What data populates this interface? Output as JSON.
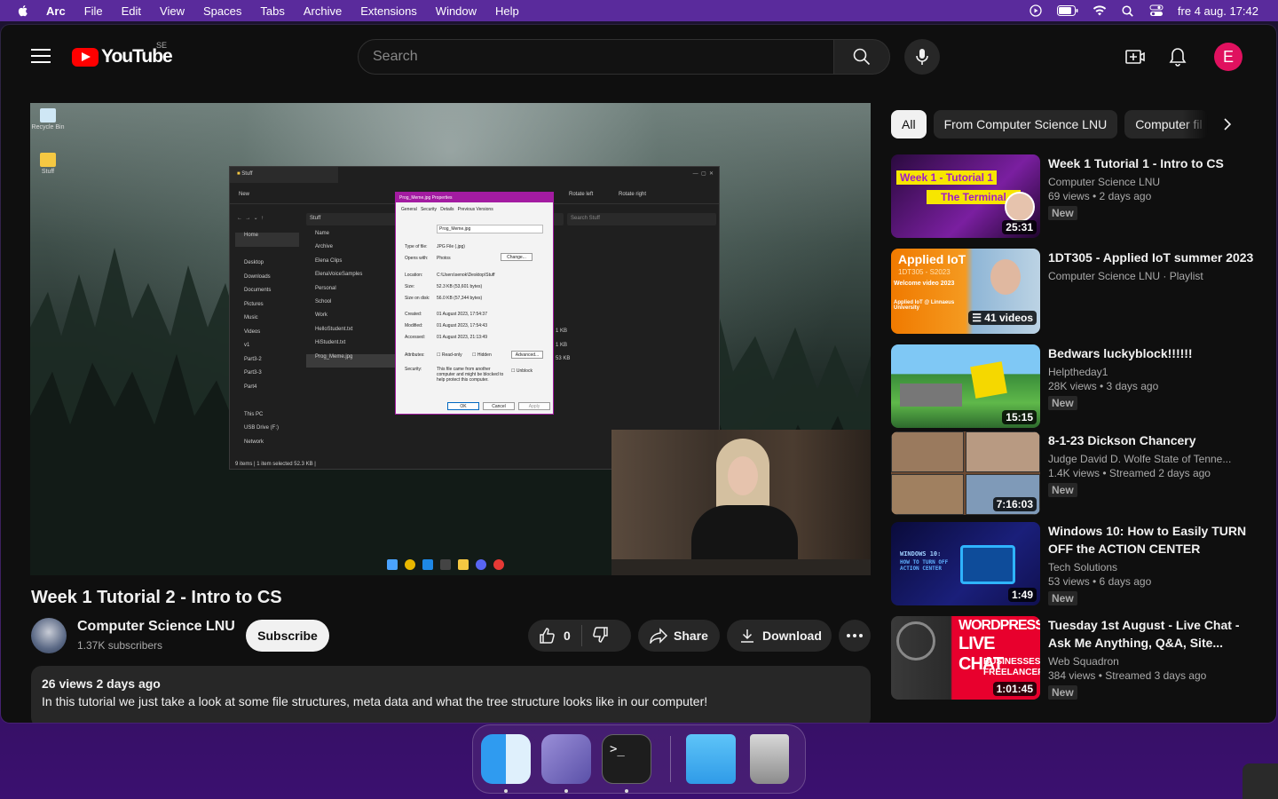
{
  "menubar": {
    "items": [
      "Arc",
      "File",
      "Edit",
      "View",
      "Spaces",
      "Tabs",
      "Archive",
      "Extensions",
      "Window",
      "Help"
    ],
    "clock": "fre 4 aug.  17:42",
    "tray_icons": [
      "play-circle-icon",
      "battery-icon",
      "wifi-icon",
      "spotlight-icon",
      "control-center-icon"
    ]
  },
  "header": {
    "logo_text": "YouTube",
    "region": "SE",
    "search_placeholder": "Search",
    "avatar_letter": "E"
  },
  "video_overlay": {
    "desktop_icons": [
      "Recycle Bin",
      "Stuff"
    ],
    "explorer": {
      "tab": "Stuff",
      "new": "New",
      "rotate_left": "Rotate left",
      "rotate_right": "Rotate right",
      "address": "Stuff",
      "search": "Search Stuff",
      "column_name": "Name",
      "sidebar": [
        "Home",
        "Desktop",
        "Downloads",
        "Documents",
        "Pictures",
        "Music",
        "Videos",
        "v1",
        "Part3-2",
        "Part3-3",
        "Part4",
        "This PC",
        "USB Drive (F:)",
        "Network"
      ],
      "files": [
        "Archive",
        "Elena Clips",
        "ElenaVoiceSamples",
        "Personal",
        "School",
        "Work",
        "HelloStudent.txt",
        "HiStudent.txt",
        "Prog_Meme.jpg"
      ],
      "sizes": [
        "1 KB",
        "1 KB",
        "53 KB"
      ],
      "status": "9 items  |  1 item selected  52.3 KB  |"
    },
    "properties": {
      "title": "Prog_Meme.jpg Properties",
      "tabs": [
        "General",
        "Security",
        "Details",
        "Previous Versions"
      ],
      "filename": "Prog_Meme.jpg",
      "type_label": "Type of file:",
      "type_value": "JPG File (.jpg)",
      "opens_label": "Opens with:",
      "opens_value": "Photos",
      "change": "Change...",
      "location_label": "Location:",
      "location_value": "C:\\Users\\senok\\Desktop\\Stuff",
      "size_label": "Size:",
      "size_value": "52.3 KB (53,601 bytes)",
      "disk_label": "Size on disk:",
      "disk_value": "56.0 KB (57,344 bytes)",
      "created_label": "Created:",
      "created_value": "01 August 2023, 17:54:37",
      "modified_label": "Modified:",
      "modified_value": "01 August 2023, 17:54:43",
      "accessed_label": "Accessed:",
      "accessed_value": "01 August 2023, 21:13:49",
      "attributes_label": "Attributes:",
      "readonly": "Read-only",
      "hidden": "Hidden",
      "advanced": "Advanced...",
      "security_label": "Security:",
      "security_text": "This file came from another computer and might be blocked to help protect this computer.",
      "unblock": "Unblock",
      "ok": "OK",
      "cancel": "Cancel",
      "apply": "Apply"
    }
  },
  "video": {
    "title": "Week 1 Tutorial 2 - Intro to CS",
    "channel": "Computer Science LNU",
    "subscribers": "1.37K subscribers",
    "subscribe": "Subscribe",
    "likes": "0",
    "share": "Share",
    "download": "Download",
    "views_date": "26 views  2 days ago",
    "description": "In this tutorial we just take a look at some file structures, meta data and what the tree structure looks like in our computer!"
  },
  "chips": [
    "All",
    "From Computer Science LNU",
    "Computer fil"
  ],
  "recommendations": [
    {
      "title": "Week 1 Tutorial 1 - Intro to CS",
      "channel": "Computer Science LNU",
      "stats": "69 views  • 2 days ago",
      "badge": "New",
      "duration": "25:31",
      "thumb_line1": "Week 1 - Tutorial 1",
      "thumb_line2": "The Terminal"
    },
    {
      "title": "1DT305 - Applied IoT summer 2023",
      "channel": "Computer Science LNU · Playlist",
      "stats": "",
      "badge": "",
      "duration": "41 videos",
      "thumb_line1": "Applied IoT",
      "thumb_line2": "1DT305 - S2023",
      "thumb_line3": "Welcome video 2023",
      "thumb_line4": "Applied IoT @ Linnaeus University"
    },
    {
      "title": "Bedwars luckyblock!!!!!!",
      "channel": "Helptheday1",
      "stats": "28K views  • 3 days ago",
      "badge": "New",
      "duration": "15:15"
    },
    {
      "title": "8-1-23 Dickson Chancery",
      "channel": "Judge David D. Wolfe State of Tenne...",
      "stats": "1.4K views  • Streamed 2 days ago",
      "badge": "New",
      "duration": "7:16:03"
    },
    {
      "title": "Windows 10: How to Easily TURN OFF the ACTION CENTER",
      "channel": "Tech Solutions",
      "stats": "53 views  • 6 days ago",
      "badge": "New",
      "duration": "1:49",
      "thumb_line1": "WINDOWS 10:",
      "thumb_line2": "HOW TO TURN OFF ACTION CENTER"
    },
    {
      "title": "Tuesday 1st August - Live Chat - Ask Me Anything, Q&A, Site...",
      "channel": "Web Squadron",
      "stats": "384 views  • Streamed 3 days ago",
      "badge": "New",
      "duration": "1:01:45",
      "thumb_line1": "WORDPRESS",
      "thumb_line2": "LIVE CHAT",
      "thumb_line3": "BUSINESSES",
      "thumb_line4": "FREELANCERS"
    }
  ],
  "dock": [
    "finder-icon",
    "arc-icon",
    "terminal-icon",
    "downloads-folder-icon",
    "trash-icon"
  ],
  "colors": {
    "accent": "#ff0000",
    "avatar": "#e0115f",
    "menubar": "#5a2b9c"
  }
}
